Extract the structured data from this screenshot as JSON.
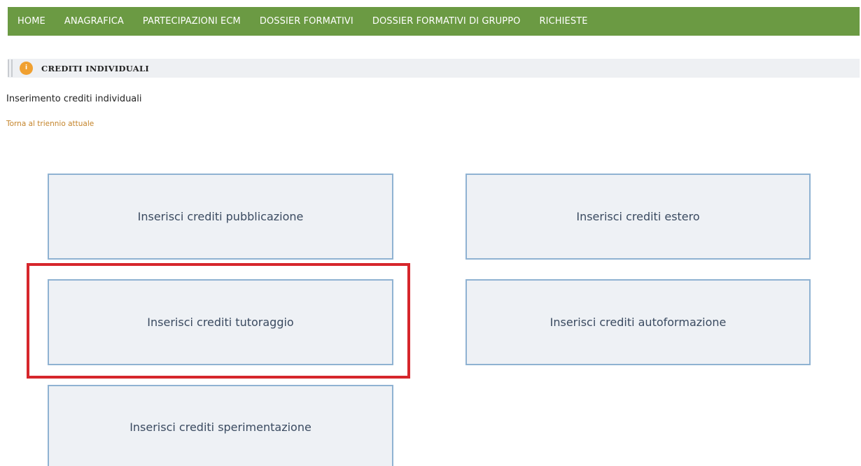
{
  "nav": {
    "items": [
      {
        "label": "HOME"
      },
      {
        "label": "ANAGRAFICA"
      },
      {
        "label": "PARTECIPAZIONI ECM"
      },
      {
        "label": "DOSSIER FORMATIVI"
      },
      {
        "label": "DOSSIER FORMATIVI DI GRUPPO"
      },
      {
        "label": "RICHIESTE"
      }
    ]
  },
  "section": {
    "title": "CREDITI INDIVIDUALI",
    "icon": "info-circle-icon"
  },
  "subtitle": "Inserimento crediti individuali",
  "back_link": "Torna al triennio attuale",
  "tiles": {
    "pubblicazione": "Inserisci crediti pubblicazione",
    "estero": "Inserisci crediti estero",
    "tutoraggio": "Inserisci crediti tutoraggio",
    "autoformazione": "Inserisci crediti autoformazione",
    "sperimentazione": "Inserisci crediti sperimentazione"
  },
  "colors": {
    "nav_background": "#6b9a43",
    "highlight": "#d6262c",
    "link": "#c4842a",
    "tile_border": "#8fb2d2"
  }
}
